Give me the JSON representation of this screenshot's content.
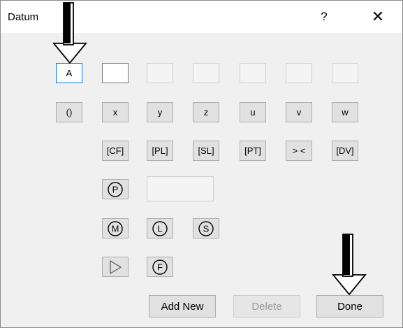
{
  "dialog": {
    "title": "Datum",
    "help_label": "?",
    "close_label": "✕"
  },
  "datum_row": {
    "selected_label": "A"
  },
  "variable_row": {
    "labels": [
      "()",
      "x",
      "y",
      "z",
      "u",
      "v",
      "w"
    ]
  },
  "code_row": {
    "labels": [
      "[CF]",
      "[PL]",
      "[SL]",
      "[PT]",
      "> <",
      "[DV]"
    ]
  },
  "modifiers": {
    "p": "P",
    "m": "M",
    "l": "L",
    "s": "S",
    "f": "F"
  },
  "buttons": {
    "add_new": "Add New",
    "delete": "Delete",
    "done": "Done"
  }
}
